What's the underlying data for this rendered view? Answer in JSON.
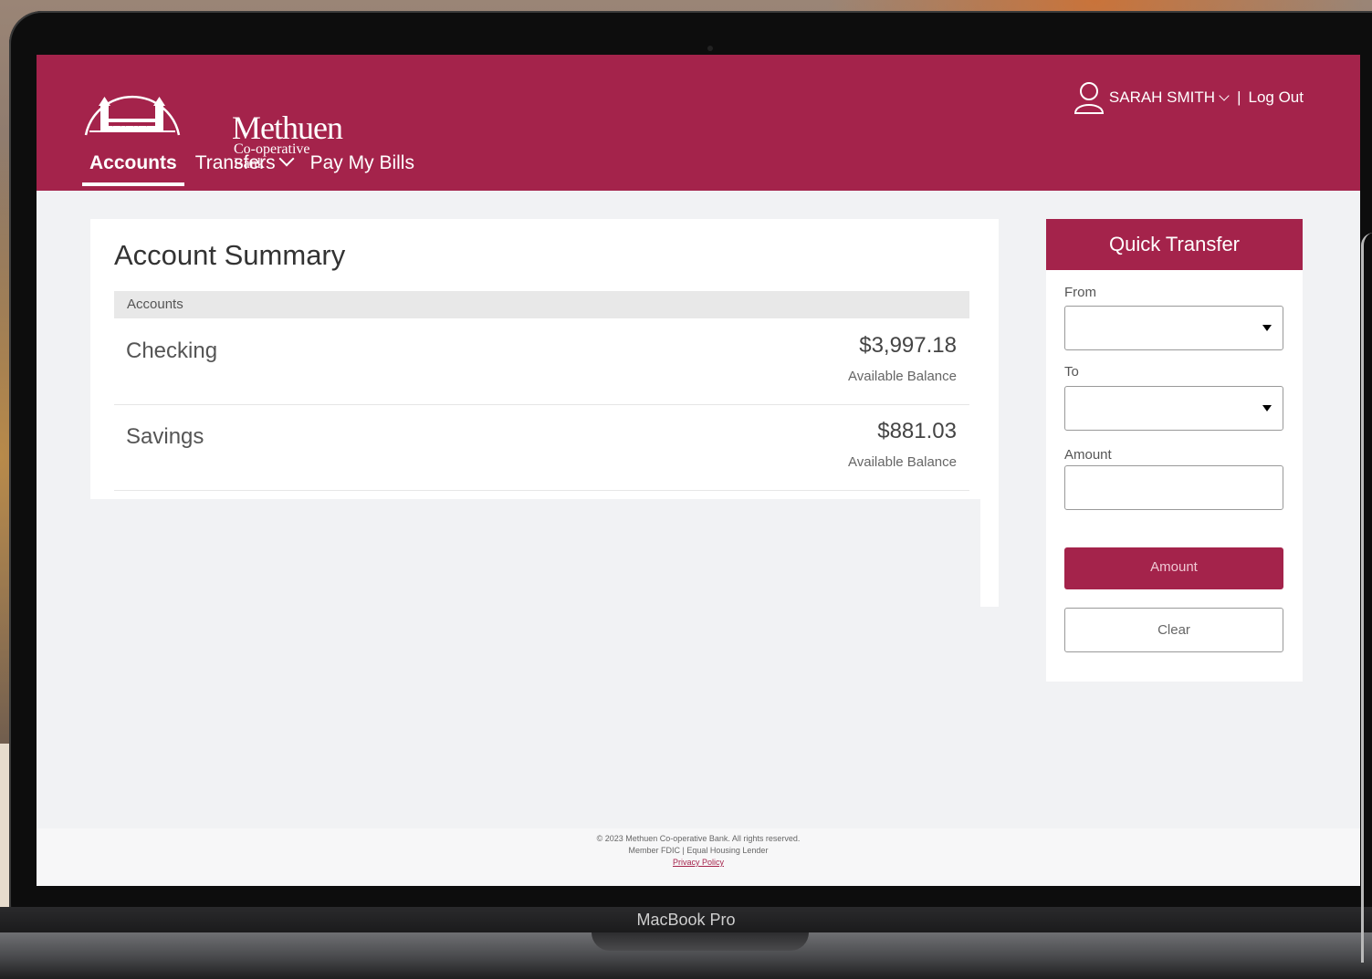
{
  "device": {
    "label": "MacBook Pro"
  },
  "brand": {
    "name": "Methuen",
    "subtitle": "Co-operative Bank",
    "color": "#a4234b"
  },
  "header": {
    "user_name": "SARAH SMITH",
    "separator": "|",
    "logout_label": "Log Out",
    "user_icon": "user-icon"
  },
  "nav": {
    "items": [
      {
        "label": "Accounts",
        "active": true
      },
      {
        "label": "Transfers",
        "dropdown": true
      },
      {
        "label": "Pay My Bills"
      }
    ]
  },
  "summary": {
    "title": "Account Summary",
    "column_header": "Accounts",
    "accounts": [
      {
        "name": "Checking",
        "balance": "$3,997.18",
        "balance_label": "Available Balance"
      },
      {
        "name": "Savings",
        "balance": "$881.03",
        "balance_label": "Available Balance"
      }
    ]
  },
  "quick_transfer": {
    "title": "Quick Transfer",
    "from_label": "From",
    "from_value": "",
    "to_label": "To",
    "to_value": "",
    "amount_label": "Amount",
    "amount_value": "",
    "submit_label": "Amount",
    "clear_label": "Clear"
  },
  "footer": {
    "copyright": "© 2023 Methuen Co-operative Bank. All rights reserved.",
    "member": "Member FDIC | Equal Housing Lender",
    "privacy_label": "Privacy Policy"
  }
}
